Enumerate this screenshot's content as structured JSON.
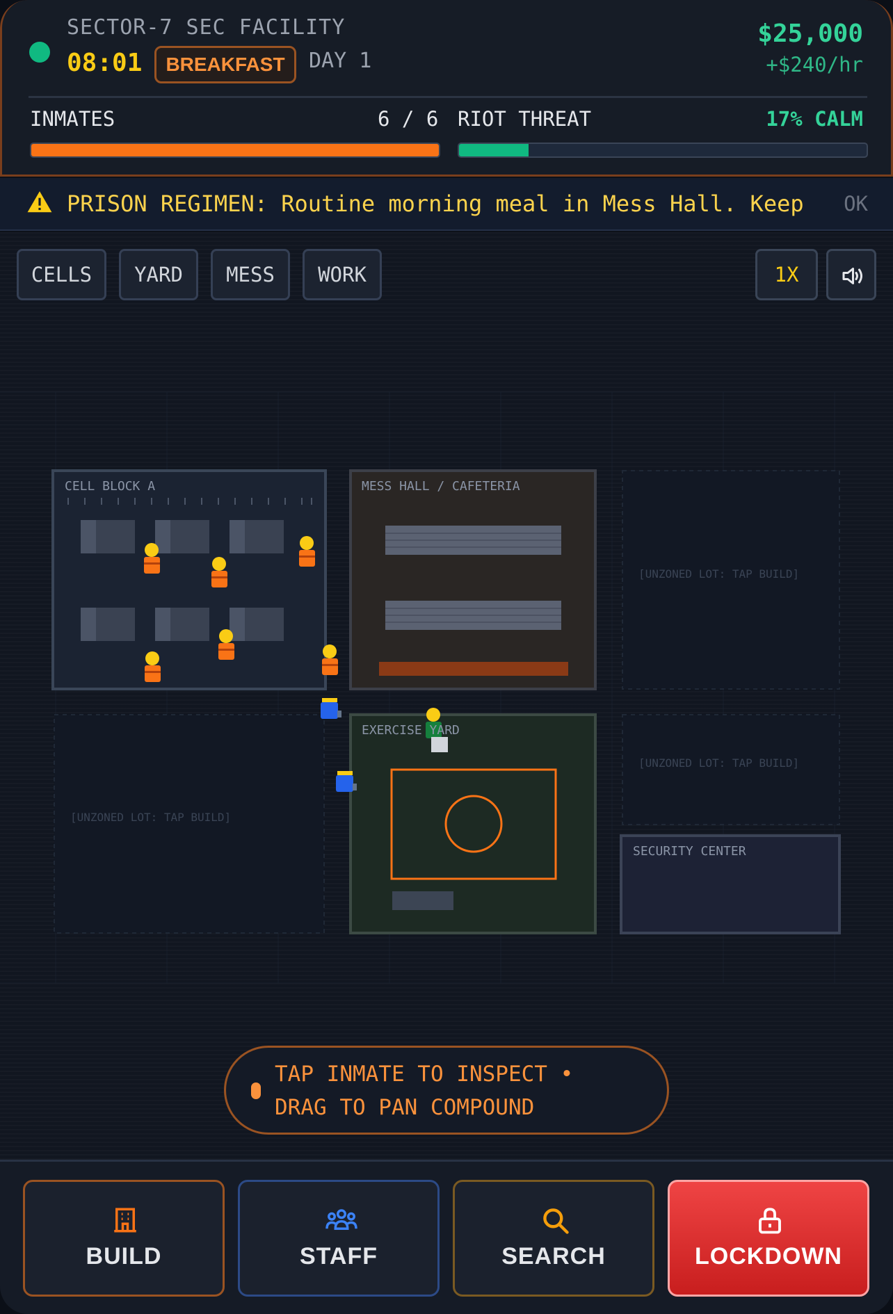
{
  "header": {
    "facility_name": "SECTOR-7 SEC FACILITY",
    "clock": "08:01",
    "phase": "BREAKFAST",
    "day": "DAY 1",
    "money": "$25,000",
    "income_rate": "+$240/hr",
    "inmates_label": "INMATES",
    "inmates_count": "6 / 6",
    "inmates_fill": 1.0,
    "riot_label": "RIOT THREAT",
    "riot_value": "17% CALM",
    "riot_fill": 0.17
  },
  "banner": {
    "text": "PRISON REGIMEN: Routine morning meal in Mess Hall. Keep",
    "ok_label": "OK",
    "icon": "warning-triangle-icon"
  },
  "map": {
    "zone_filters": [
      "CELLS",
      "YARD",
      "MESS",
      "WORK"
    ],
    "speed_label": "1X",
    "sound_icon": "speaker-volume-icon",
    "rooms": {
      "cell_block": "CELL BLOCK A",
      "mess_hall": "MESS HALL / CAFETERIA",
      "exercise_yard": "EXERCISE YARD",
      "security": "SECURITY CENTER",
      "unzoned": "[UNZONED LOT: TAP BUILD]"
    },
    "hint": "TAP INMATE TO INSPECT • DRAG TO PAN COMPOUND"
  },
  "actions": [
    {
      "label": "BUILD",
      "icon": "building-icon"
    },
    {
      "label": "STAFF",
      "icon": "people-group-icon"
    },
    {
      "label": "SEARCH",
      "icon": "magnifier-icon"
    },
    {
      "label": "LOCKDOWN",
      "icon": "padlock-icon"
    }
  ],
  "colors": {
    "accent_orange": "#f97316",
    "money_green": "#34d399",
    "clock_yellow": "#facc15",
    "lockdown_red": "#ef4444",
    "guard_blue": "#2563eb",
    "inmate_orange": "#f97316"
  }
}
